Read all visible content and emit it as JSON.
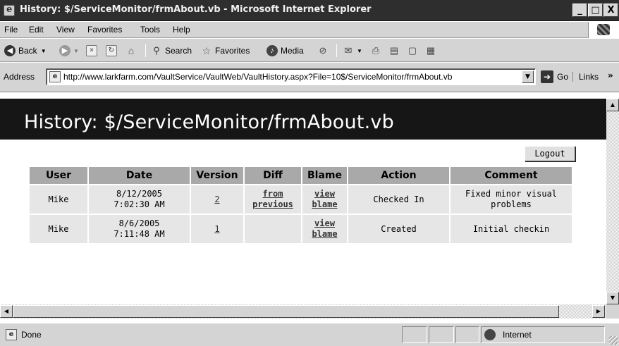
{
  "window": {
    "title": "History: $/ServiceMonitor/frmAbout.vb - Microsoft Internet Explorer",
    "min_label": "_",
    "max_label": "□",
    "close_label": "X"
  },
  "menu": {
    "items": [
      "File",
      "Edit",
      "View",
      "Favorites",
      "Tools",
      "Help"
    ]
  },
  "toolbar": {
    "back_label": "Back",
    "search_label": "Search",
    "favorites_label": "Favorites",
    "media_label": "Media"
  },
  "address": {
    "label": "Address",
    "url": "http://www.larkfarm.com/VaultService/VaultWeb/VaultHistory.aspx?File=10$/ServiceMonitor/frmAbout.vb",
    "go_label": "Go",
    "links_label": "Links",
    "chevron": "»"
  },
  "page": {
    "heading": "History: $/ServiceMonitor/frmAbout.vb",
    "logout_label": "Logout"
  },
  "table": {
    "headers": {
      "user": "User",
      "date": "Date",
      "version": "Version",
      "diff": "Diff",
      "blame": "Blame",
      "action": "Action",
      "comment": "Comment"
    },
    "rows": [
      {
        "user": "Mike",
        "date_line1": "8/12/2005",
        "date_line2": "7:02:30 AM",
        "version": "2",
        "diff_line1": "from",
        "diff_line2": "previous",
        "blame_line1": "view",
        "blame_line2": "blame",
        "action": "Checked In",
        "comment_line1": "Fixed minor visual",
        "comment_line2": "problems"
      },
      {
        "user": "Mike",
        "date_line1": "8/6/2005",
        "date_line2": "7:11:48 AM",
        "version": "1",
        "diff_line1": "",
        "diff_line2": "",
        "blame_line1": "view",
        "blame_line2": "blame",
        "action": "Created",
        "comment_line1": "Initial checkin",
        "comment_line2": ""
      }
    ]
  },
  "status": {
    "text": "Done",
    "zone": "Internet"
  }
}
